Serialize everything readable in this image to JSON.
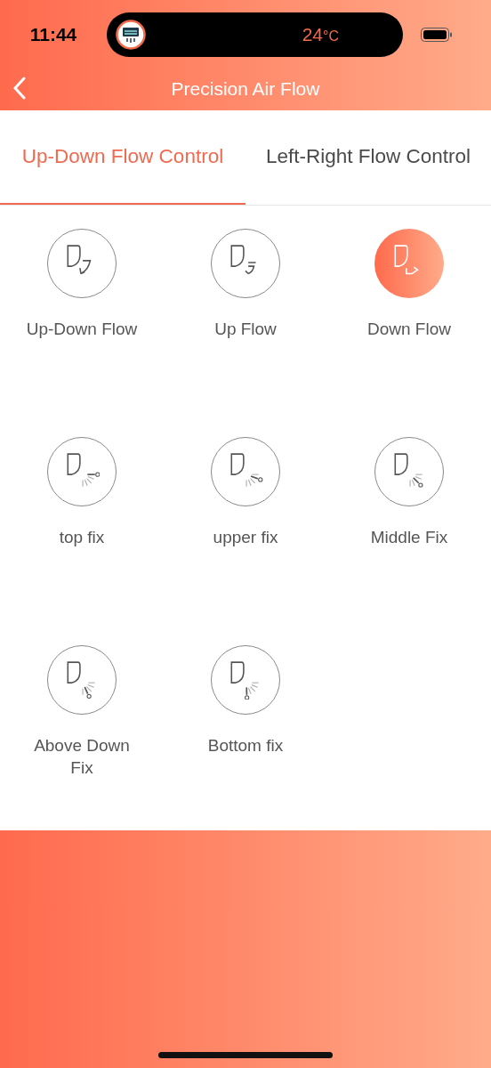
{
  "status_bar": {
    "time": "11:44",
    "live_activity": {
      "temperature": "24",
      "unit": "°C"
    }
  },
  "header": {
    "title": "Precision Air Flow"
  },
  "tabs": [
    {
      "label": "Up-Down Flow Control",
      "selected": true
    },
    {
      "label": "Left-Right Flow Control",
      "selected": false
    }
  ],
  "modes": [
    {
      "label": "Up-Down Flow",
      "kind": "swing-both",
      "selected": false
    },
    {
      "label": "Up Flow",
      "kind": "swing-up",
      "selected": false
    },
    {
      "label": "Down Flow",
      "kind": "swing-down",
      "selected": true
    },
    {
      "label": "top fix",
      "kind": "fix-top",
      "selected": false
    },
    {
      "label": "upper fix",
      "kind": "fix-upper",
      "selected": false
    },
    {
      "label": "Middle Fix",
      "kind": "fix-middle",
      "selected": false
    },
    {
      "label": "Above Down Fix",
      "kind": "fix-lower",
      "selected": false
    },
    {
      "label": "Bottom fix",
      "kind": "fix-bottom",
      "selected": false
    }
  ]
}
